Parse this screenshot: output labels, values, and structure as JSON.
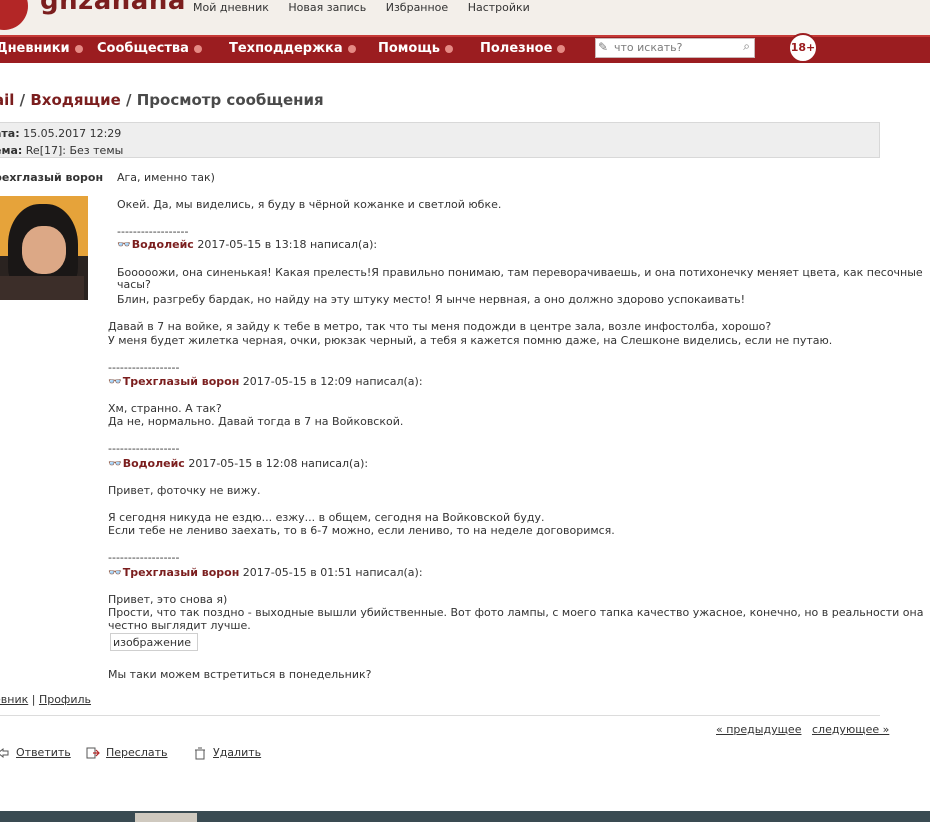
{
  "header": {
    "logo_text": "ghzanana",
    "top_links": [
      "Мой дневник",
      "Новая запись",
      "Избранное",
      "Настройки"
    ]
  },
  "nav": {
    "items": [
      "Дневники",
      "Сообщества",
      "Техподдержка",
      "Помощь",
      "Полезное"
    ],
    "search_placeholder": "что искать?",
    "age_badge": "18+"
  },
  "breadcrumb": {
    "part1": "ail",
    "sep1": " / ",
    "part2": "Входящие",
    "sep2": " / ",
    "part3": "Просмотр сообщения"
  },
  "meta": {
    "date_label": "ата:",
    "date_value": "15.05.2017 12:29",
    "subject_label": "ема:",
    "subject_value": "Re[17]: Без темы"
  },
  "author": {
    "name": "рехглазый ворон"
  },
  "message": {
    "l1": "Ага, именно так)",
    "l2": "Окей. Да, мы виделись, я буду в чёрной кожанке и светлой юбке.",
    "dash1": "------------------",
    "q1_name": "Водолейс",
    "q1_meta": "2017-05-15 в 13:18 написал(а):",
    "l3": "Бооооожи, она синенькая! Какая прелесть!Я правильно понимаю, там переворачиваешь, и она потихонечку меняет цвета, как песочные",
    "l4": "часы?",
    "l5": "Блин, разгребу бардак, но найду на эту штуку место! Я ынче нервная, а оно должно здорово успокаивать!",
    "l6": "Давай в 7 на войке, я зайду к тебе в метро, так что ты меня подожди в центре зала, возле инфостолба, хорошо?",
    "l7": "У меня будет жилетка черная, очки, рюкзак черный, а тебя я кажется помню даже, на Слешконе виделись, если не путаю.",
    "dash2": "------------------",
    "q2_name": "Трехглазый ворон",
    "q2_meta": "2017-05-15 в 12:09 написал(а):",
    "l8": "Хм, странно. А так?",
    "l9": "Да не, нормально. Давай тогда в 7 на Войковской.",
    "dash3": "------------------",
    "q3_name": "Водолейс",
    "q3_meta": "2017-05-15 в 12:08 написал(а):",
    "l10": "Привет, фоточку не вижу.",
    "l11": "Я сегодня никуда не ездю... езжу... в общем, сегодня на Войковской буду.",
    "l12": "Если тебе не лениво заехать, то в 6-7 можно, если лениво, то на неделе договоримся.",
    "dash4": "------------------",
    "q4_name": "Трехглазый ворон",
    "q4_meta": "2017-05-15 в 01:51 написал(а):",
    "l13": "Привет, это снова я)",
    "l14": "Прости, что так поздно - выходные вышли убийственные. Вот фото лампы, с моего тапка качество ужасное, конечно, но в реальности она",
    "l15": "честно выглядит лучше.",
    "img_alt": "изображение",
    "l16": "Мы таки можем встретиться в понедельник?"
  },
  "footer": {
    "link1": "евник",
    "divider": " | ",
    "link2": "Профиль",
    "prev": "« предыдущее",
    "next": "следующее »",
    "reply": "Ответить",
    "forward": "Переслать",
    "delete": "Удалить"
  },
  "colors": {
    "nav_bg": "#9b1d20",
    "link": "#7b1e1e"
  }
}
